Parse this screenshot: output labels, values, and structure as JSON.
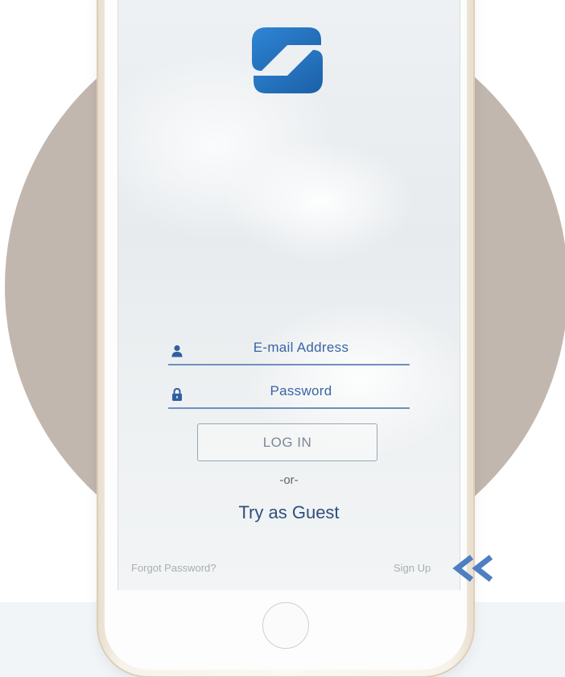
{
  "login": {
    "email_placeholder": "E-mail Address",
    "password_placeholder": "Password",
    "login_button": "LOG IN",
    "or_separator": "-or-",
    "guest_link": "Try as Guest",
    "forgot_password": "Forgot Password?",
    "sign_up": "Sign Up"
  },
  "icons": {
    "logo": "s-logo",
    "email": "user-icon",
    "password": "lock-icon",
    "pointer": "double-chevron-left-icon",
    "home": "home-button"
  },
  "colors": {
    "brand_blue": "#1f6fb8",
    "field_text": "#3a64a6",
    "circle_bg": "#c2b7ae",
    "arrow": "#4f7fc2"
  }
}
